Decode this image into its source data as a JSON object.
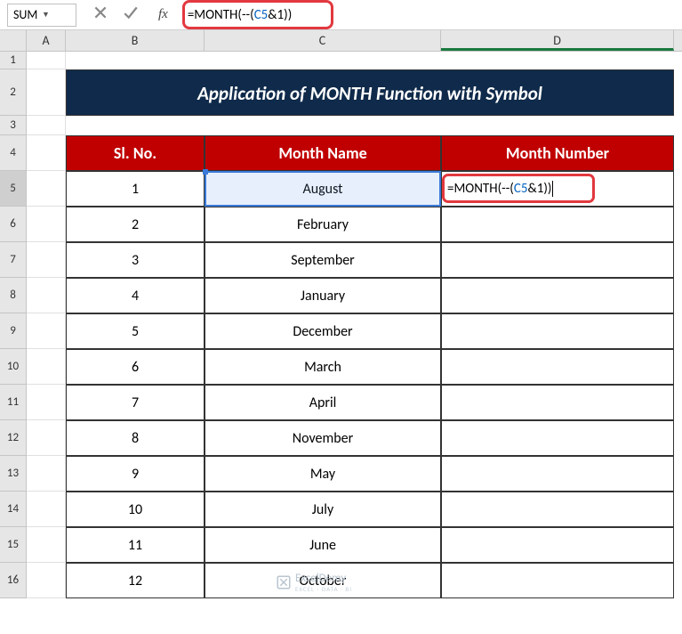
{
  "name_box": "SUM",
  "formula_bar": {
    "prefix": "=MONTH(--(",
    "ref": "C5",
    "amp": "&",
    "one": "1",
    "suffix": "))"
  },
  "columns": {
    "A": "A",
    "B": "B",
    "C": "C",
    "D": "D"
  },
  "row_numbers": [
    "1",
    "2",
    "3",
    "4",
    "5",
    "6",
    "7",
    "8",
    "9",
    "10",
    "11",
    "12",
    "13",
    "14",
    "15",
    "16"
  ],
  "title": "Application of MONTH Function with Symbol",
  "headers": {
    "sl": "Sl. No.",
    "name": "Month Name",
    "num": "Month Number"
  },
  "rows": [
    {
      "sl": "1",
      "name": "August",
      "num": ""
    },
    {
      "sl": "2",
      "name": "February",
      "num": ""
    },
    {
      "sl": "3",
      "name": "September",
      "num": ""
    },
    {
      "sl": "4",
      "name": "January",
      "num": ""
    },
    {
      "sl": "5",
      "name": "December",
      "num": ""
    },
    {
      "sl": "6",
      "name": "March",
      "num": ""
    },
    {
      "sl": "7",
      "name": "April",
      "num": ""
    },
    {
      "sl": "8",
      "name": "November",
      "num": ""
    },
    {
      "sl": "9",
      "name": "May",
      "num": ""
    },
    {
      "sl": "10",
      "name": "July",
      "num": ""
    },
    {
      "sl": "11",
      "name": "June",
      "num": ""
    },
    {
      "sl": "12",
      "name": "October",
      "num": ""
    }
  ],
  "edit_formula": {
    "prefix": "=MONTH(--(",
    "ref": "C5",
    "amp": "&",
    "one": "1",
    "suffix": "))"
  },
  "watermark": {
    "brand": "ExcelDemy",
    "tag": "EXCEL · DATA · BI"
  }
}
